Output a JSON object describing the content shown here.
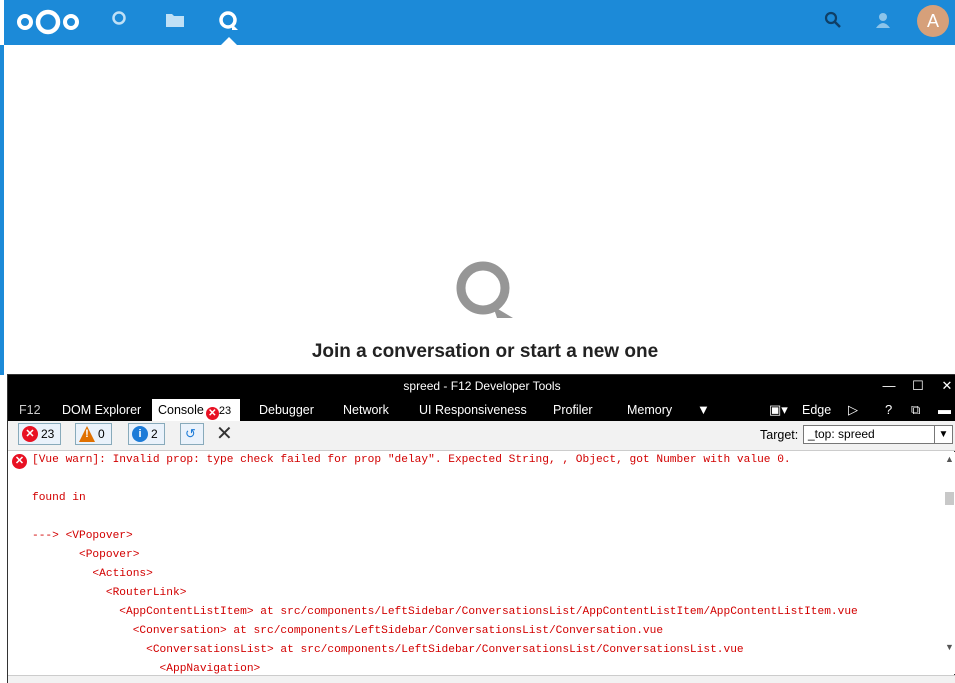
{
  "header": {
    "nav": [
      {
        "name": "logo",
        "icon": "nextcloud-logo-icon"
      },
      {
        "name": "dashboard",
        "icon": "circle-icon"
      },
      {
        "name": "files",
        "icon": "folder-icon"
      },
      {
        "name": "talk",
        "icon": "talk-icon",
        "active": true
      }
    ],
    "right_icons": [
      "search-icon",
      "contacts-icon"
    ],
    "avatar_letter": "A",
    "colors": {
      "bar": "#1c8ad8",
      "avatar": "#d6a07a"
    }
  },
  "main": {
    "empty_message": "Join a conversation or start a new one"
  },
  "devtools": {
    "window_title": "spreed - F12 Developer Tools",
    "tabs": [
      {
        "label": "F12"
      },
      {
        "label": "DOM Explorer"
      },
      {
        "label": "Console",
        "badge": "23",
        "active": true
      },
      {
        "label": "Debugger"
      },
      {
        "label": "Network"
      },
      {
        "label": "UI Responsiveness"
      },
      {
        "label": "Profiler"
      },
      {
        "label": "Memory"
      }
    ],
    "browser_mode": "Edge",
    "filters": {
      "errors": "23",
      "warnings": "0",
      "info": "2"
    },
    "target_label": "Target:",
    "target_value": "_top: spreed",
    "console_lines": [
      "[Vue warn]: Invalid prop: type check failed for prop \"delay\". Expected String, , Object, got Number with value 0.",
      "",
      "found in",
      "",
      "---> <VPopover>",
      "       <Popover>",
      "         <Actions>",
      "           <RouterLink>",
      "             <AppContentListItem> at src/components/LeftSidebar/ConversationsList/AppContentListItem/AppContentListItem.vue",
      "               <Conversation> at src/components/LeftSidebar/ConversationsList/Conversation.vue",
      "                 <ConversationsList> at src/components/LeftSidebar/ConversationsList/ConversationsList.vue",
      "                   <AppNavigation>"
    ]
  }
}
